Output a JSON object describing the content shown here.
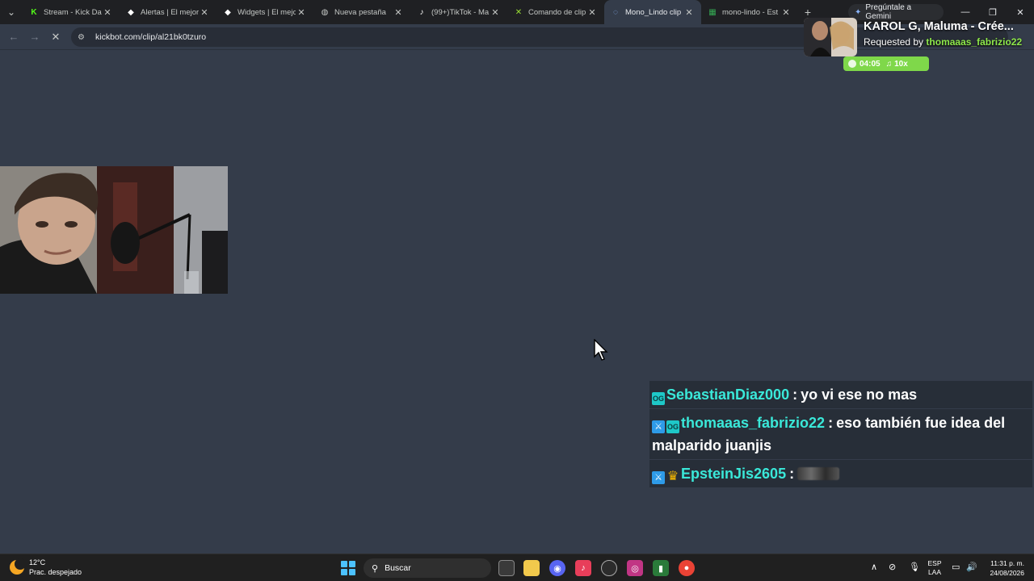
{
  "browser": {
    "tabs": [
      {
        "title": "Stream - Kick Das",
        "favicon": "kick-icon",
        "color": "#53fc18"
      },
      {
        "title": "Alertas | El mejor",
        "favicon": "diamond-icon",
        "color": "#ffffff"
      },
      {
        "title": "Widgets | El mejo",
        "favicon": "diamond-icon",
        "color": "#ffffff"
      },
      {
        "title": "Nueva pestaña",
        "favicon": "chrome-icon",
        "color": "#c4c7c5"
      },
      {
        "title": "(99+)TikTok - Ma",
        "favicon": "tiktok-icon",
        "color": "#ffffff"
      },
      {
        "title": "Comando de clip",
        "favicon": "kickbot-icon",
        "color": "#9be234"
      },
      {
        "title": "Mono_Lindo clip",
        "favicon": "globe-icon",
        "color": "#8ab4f8"
      },
      {
        "title": "mono-lindo - Est",
        "favicon": "sheet-icon",
        "color": "#34a853"
      }
    ],
    "active_tab": 6,
    "gemini_label": "Pregúntale a Gemini",
    "url": "kickbot.com/clip/al21bk0tzuro"
  },
  "music": {
    "title": "KAROL G, Maluma - Crée...",
    "requested_by_label": "Requested by",
    "requested_by_user": "thomaaas_fabrizio22",
    "time": "04:05",
    "volume": "10x",
    "accent": "#7fd84a"
  },
  "chat": {
    "messages": [
      {
        "badges": [
          "og"
        ],
        "user": "SebastianDiaz000",
        "text": "yo vi ese no mas",
        "blurred": false
      },
      {
        "badges": [
          "mod",
          "og"
        ],
        "user": "thomaaas_fabrizio22",
        "text": "eso también fue idea del malparido juanjis",
        "blurred": false
      },
      {
        "badges": [
          "mod",
          "vip"
        ],
        "user": "EpsteinJis2605",
        "text": "",
        "blurred": true
      }
    ],
    "separator": ":"
  },
  "taskbar": {
    "temperature": "12°C",
    "weather_desc": "Prac. despejado",
    "search_placeholder": "Buscar",
    "language_top": "ESP",
    "language_bottom": "LAA",
    "time": "11:31 p. m.",
    "date": "24/08/2026"
  }
}
